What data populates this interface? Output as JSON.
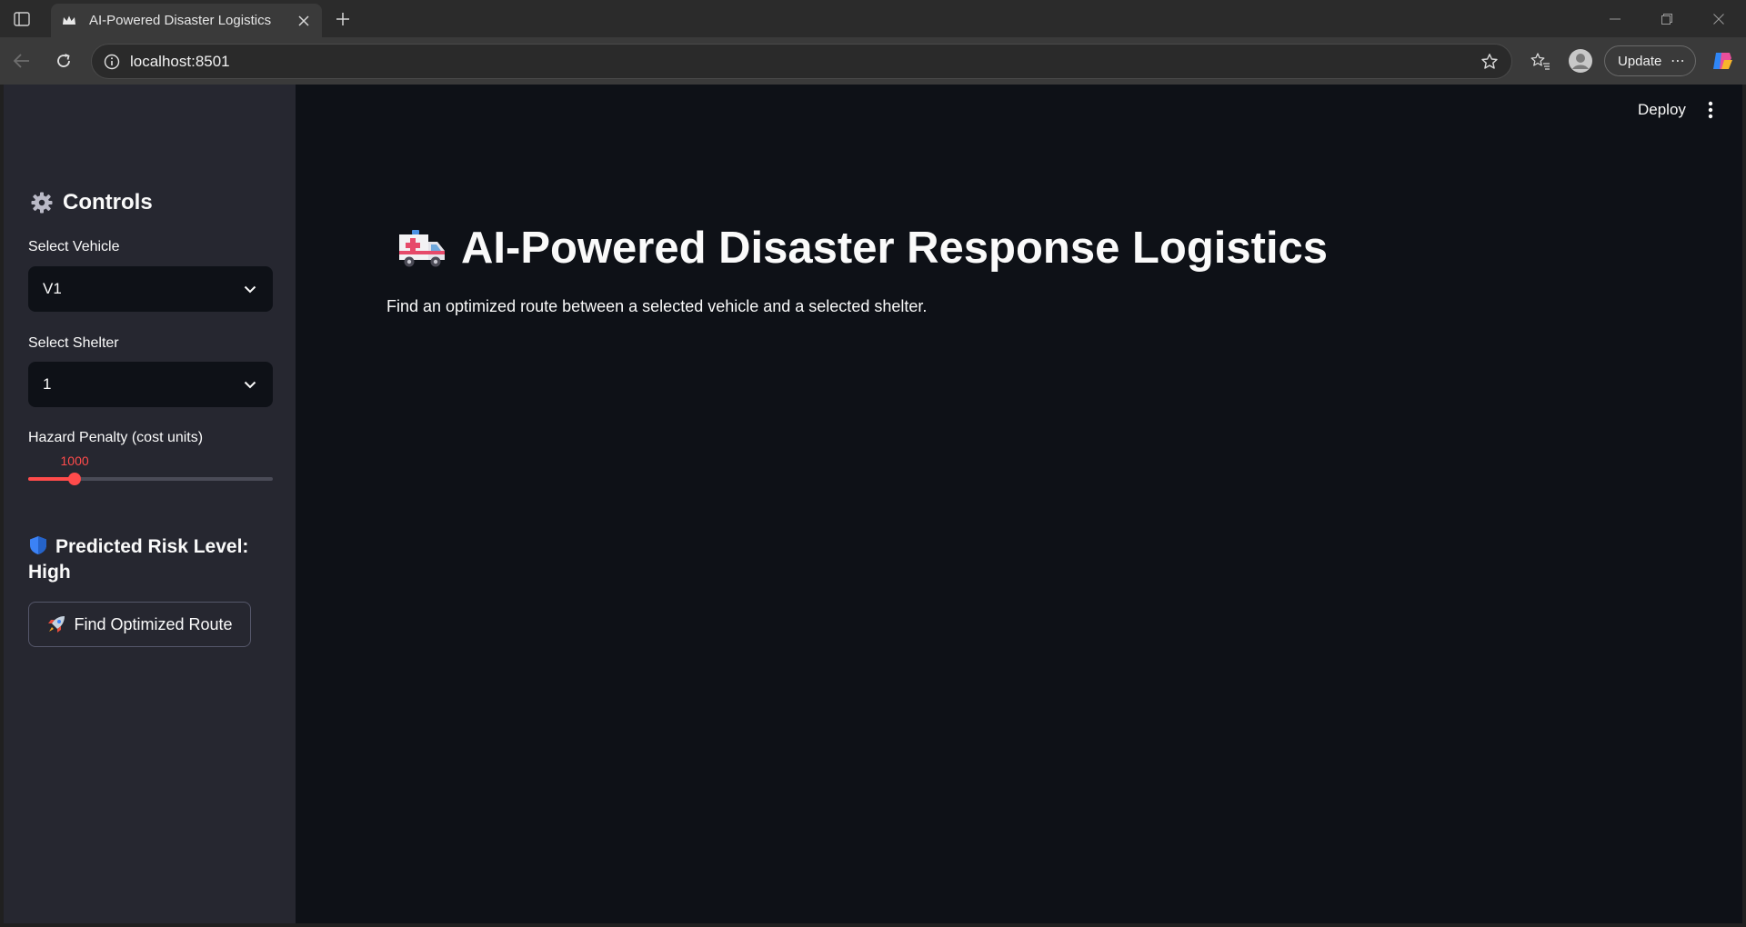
{
  "browser": {
    "tab_title": "AI-Powered Disaster Logistics",
    "url": "localhost:8501",
    "update_label": "Update",
    "update_more": "⋯"
  },
  "app": {
    "deploy_label": "Deploy",
    "sidebar": {
      "heading": "Controls",
      "vehicle": {
        "label": "Select Vehicle",
        "value": "V1"
      },
      "shelter": {
        "label": "Select Shelter",
        "value": "1"
      },
      "hazard": {
        "label": "Hazard Penalty (cost units)",
        "value": "1000",
        "fraction": 0.19
      },
      "risk": {
        "label": "Predicted Risk Level:",
        "value": "High"
      },
      "route_button": "Find Optimized Route"
    },
    "main": {
      "title": "AI-Powered Disaster Response Logistics",
      "description": "Find an optimized route between a selected vehicle and a selected shelter."
    }
  },
  "colors": {
    "accent": "#ff4b4b",
    "sidebar_bg": "#262730",
    "main_bg": "#0e1117"
  }
}
